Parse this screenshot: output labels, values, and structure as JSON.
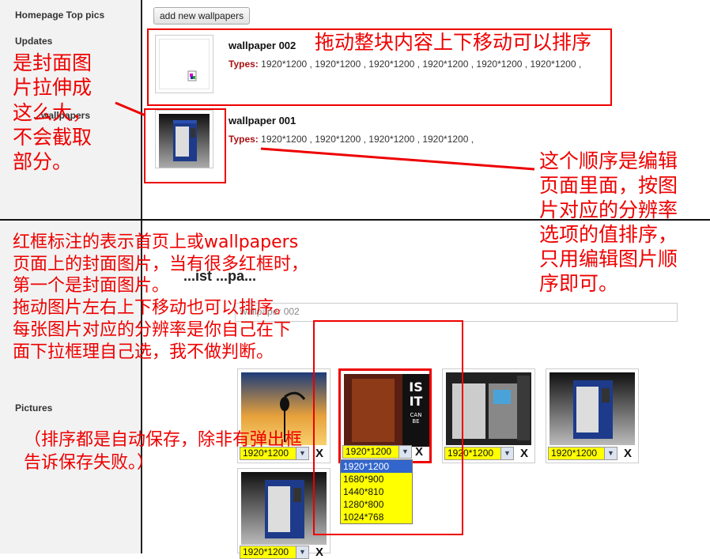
{
  "top": {
    "sidebar": {
      "items": [
        "Homepage Top pics",
        "Updates",
        "...wallpapers"
      ]
    },
    "add_button": "add new wallpapers",
    "wallpapers": [
      {
        "title": "wallpaper 002",
        "types_label": "Types:",
        "types": "1920*1200 , 1920*1200 , 1920*1200 , 1920*1200 , 1920*1200 , 1920*1200 ,"
      },
      {
        "title": "wallpaper 001",
        "types_label": "Types:",
        "types": "1920*1200 , 1920*1200 , 1920*1200 , 1920*1200 ,"
      }
    ],
    "annotations": {
      "drag_sort": "拖动整块内容上下移动可以排序",
      "cover_stretch": "是封面图\n片拉伸成\n这么大，\n不会截取\n部分。",
      "order_note": "这个顺序是编辑\n页面里面，按图\n片对应的分辨率\n选项的值排序，\n只用编辑图片顺\n序即可。"
    }
  },
  "bottom": {
    "sidebar": {
      "items": [
        "Pictures"
      ]
    },
    "name_input": "wallpaper 002",
    "page_title": "...ist ...pa...",
    "annotations": {
      "main": "红框标注的表示首页上或wallpapers\n页面上的封面图片，当有很多红框时，\n第一个是封面图片。\n拖动图片左右上下移动也可以排序。\n每张图片对应的分辨率是你自己在下\n面下拉框理自己选，我不做判断。",
      "autosave": "（排序都是自动保存，除非有弹出框\n告诉保存失败。）"
    },
    "tiles": [
      {
        "resolution": "1920*1200",
        "delete": "X"
      },
      {
        "resolution": "1920*1200",
        "delete": "X"
      },
      {
        "resolution": "1920*1200",
        "delete": "X"
      },
      {
        "resolution": "1920*1200",
        "delete": "X"
      },
      {
        "resolution": "1920*1200",
        "delete": "X"
      }
    ],
    "dropdown_options": [
      "1920*1200",
      "1680*900",
      "1440*810",
      "1280*800",
      "1024*768"
    ],
    "dropdown_selected": "1920*1200"
  },
  "colors": {
    "annotation": "#e00000",
    "select_bg": "#ffff00",
    "selected_option": "#3366cc"
  }
}
